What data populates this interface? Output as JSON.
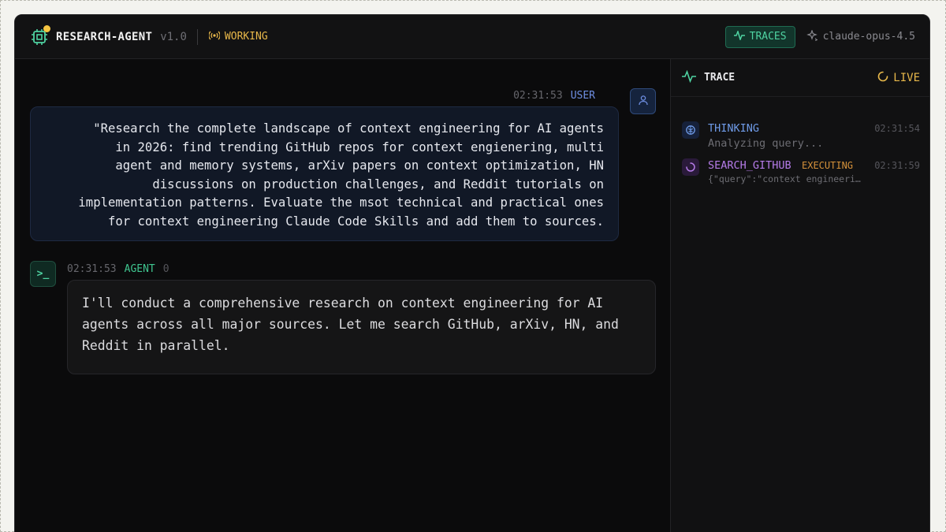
{
  "header": {
    "title": "RESEARCH-AGENT",
    "version": "v1.0",
    "status": "WORKING",
    "traces_label": "TRACES",
    "model": "claude-opus-4.5"
  },
  "messages": {
    "user": {
      "time": "02:31:53",
      "role": "USER",
      "text": "\"Research the complete landscape of context engineering for AI agents\nin 2026: find trending GitHub repos for context engienering, multi\nagent and memory systems, arXiv papers on context optimization, HN\ndiscussions on production challenges, and Reddit tutorials on\nimplementation patterns. Evaluate the msot technical and practical ones\nfor context engineering Claude Code Skills and add them to sources."
    },
    "agent": {
      "time": "02:31:53",
      "role": "AGENT",
      "count": "0",
      "avatar_glyph": ">_",
      "text": "I'll conduct a comprehensive research on context engineering for AI agents across all major sources. Let me search GitHub, arXiv, HN, and Reddit in parallel."
    }
  },
  "trace": {
    "title": "TRACE",
    "live_label": "LIVE",
    "items": [
      {
        "name": "THINKING",
        "time": "02:31:54",
        "detail": "Analyzing query...",
        "icon": "brain-icon",
        "color": "#6f9be8"
      },
      {
        "name": "SEARCH_GITHUB",
        "tag": "EXECUTING",
        "time": "02:31:59",
        "detail": "{\"query\":\"context engineeri…",
        "icon": "spinner-icon",
        "color": "#b57be8"
      }
    ]
  },
  "colors": {
    "accent_green": "#4fd3a2",
    "status_yellow": "#e8b84a",
    "user_blue": "#6f8fe3",
    "tool_purple": "#b57be8"
  }
}
